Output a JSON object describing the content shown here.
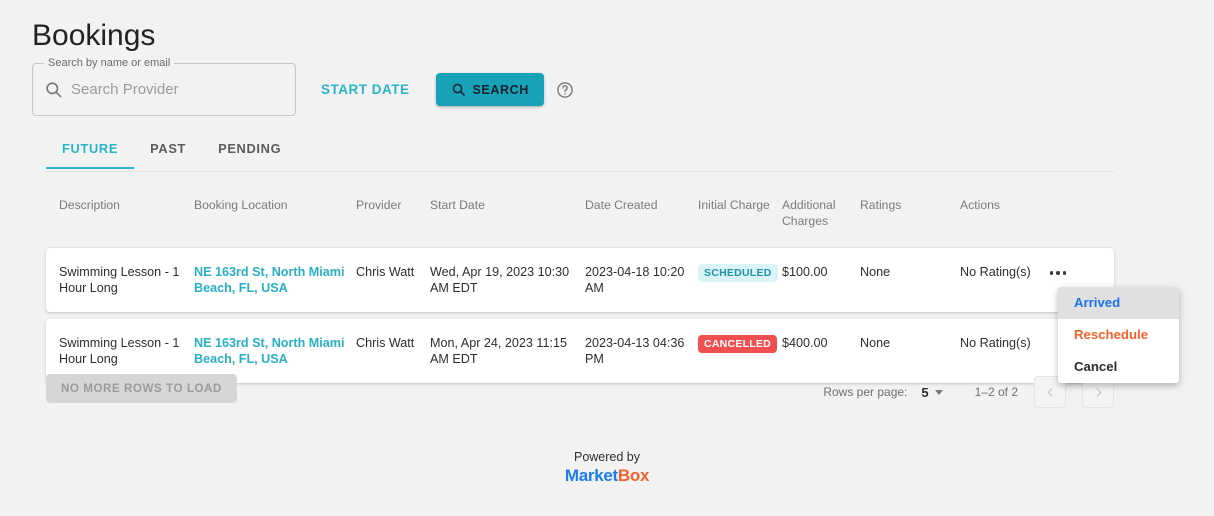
{
  "page": {
    "title": "Bookings"
  },
  "search": {
    "label": "Search by name or email",
    "placeholder": "Search Provider",
    "value": "",
    "search_icon": "search-icon",
    "start_date_label": "START DATE",
    "search_button_label": "SEARCH",
    "help_icon": "help-circle-icon",
    "accent_color": "#17a2b8",
    "link_color": "#2ab4c8"
  },
  "tabs": [
    {
      "label": "FUTURE",
      "active": true
    },
    {
      "label": "PAST",
      "active": false
    },
    {
      "label": "PENDING",
      "active": false
    }
  ],
  "table": {
    "columns": [
      "Description",
      "Booking Location",
      "Provider",
      "Start Date",
      "Date Created",
      "Initial Charge",
      "Additional Charges",
      "Ratings",
      "Actions"
    ],
    "rows": [
      {
        "description": "Swimming Lesson - 1 Hour Long",
        "booking_location": "NE 163rd St, North Miami Beach, FL, USA",
        "provider": "Chris Watt",
        "start_date": "Wed, Apr 19, 2023 10:30 AM EDT",
        "date_created": "2023-04-18 10:20 AM",
        "status": "SCHEDULED",
        "status_type": "scheduled",
        "initial_charge": "$100.00",
        "additional_charges": "None",
        "ratings": "No Rating(s)",
        "actions_icon": "more-horizontal-icon"
      },
      {
        "description": "Swimming Lesson - 1 Hour Long",
        "booking_location": "NE 163rd St, North Miami Beach, FL, USA",
        "provider": "Chris Watt",
        "start_date": "Mon, Apr 24, 2023 11:15 AM EDT",
        "date_created": "2023-04-13 04:36 PM",
        "status": "CANCELLED",
        "status_type": "cancelled",
        "initial_charge": "$400.00",
        "additional_charges": "None",
        "ratings": "No Rating(s)",
        "actions_icon": "more-horizontal-icon"
      }
    ]
  },
  "actions_menu": {
    "items": [
      {
        "label": "Arrived",
        "color": "#1a73e8",
        "highlighted": true
      },
      {
        "label": "Reschedule",
        "color": "#f4622c",
        "highlighted": false
      },
      {
        "label": "Cancel",
        "color": "#2b2b2b",
        "highlighted": false
      }
    ]
  },
  "bottom": {
    "no_more_rows_label": "NO MORE ROWS TO LOAD",
    "rows_per_page_label": "Rows per page:",
    "rows_per_page_value": "5",
    "range_label": "1–2 of 2",
    "prev_icon": "chevron-left-icon",
    "next_icon": "chevron-right-icon"
  },
  "footer": {
    "powered_by": "Powered by",
    "brand_first": "Market",
    "brand_second": "Box",
    "brand_first_color": "#1d7ce8",
    "brand_second_color": "#f4622c"
  }
}
